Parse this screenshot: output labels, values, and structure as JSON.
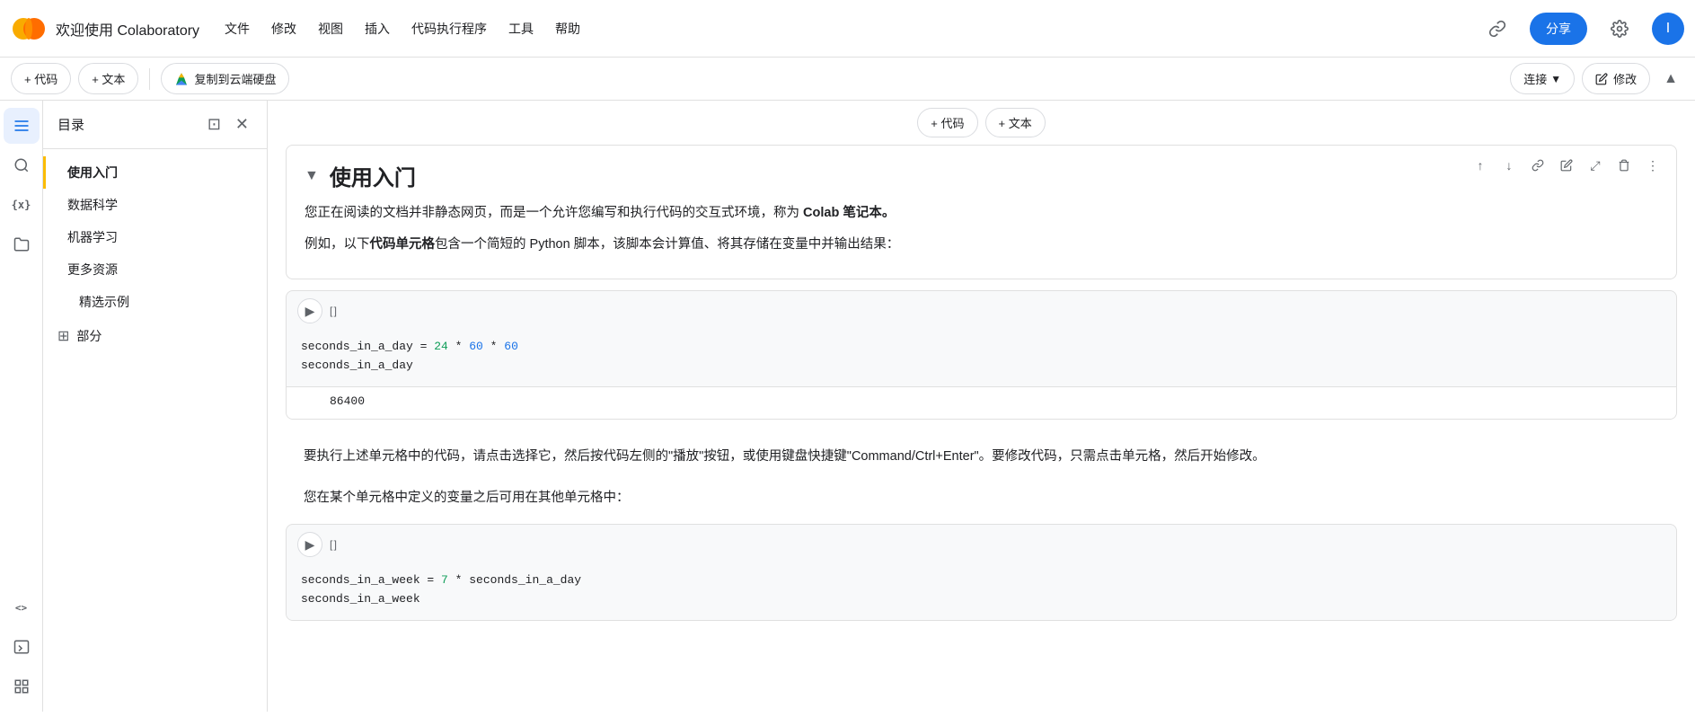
{
  "app": {
    "logo_text": "CO",
    "title": "欢迎使用 Colaboratory"
  },
  "menu": {
    "items": [
      "文件",
      "修改",
      "视图",
      "插入",
      "代码执行程序",
      "工具",
      "帮助"
    ]
  },
  "top_bar_right": {
    "link_icon": "🔗",
    "share_label": "分享",
    "settings_icon": "⚙",
    "user_avatar": "I"
  },
  "toolbar": {
    "add_code": "+ 代码",
    "add_text": "+ 文本",
    "copy_to_drive": "复制到云端硬盘",
    "connect_label": "连接",
    "edit_label": "修改",
    "collapse_icon": "▲"
  },
  "cell_insert": {
    "add_code": "+ 代码",
    "add_text": "+ 文本"
  },
  "sidebar": {
    "title": "目录",
    "toc_items": [
      {
        "label": "使用入门",
        "active": true,
        "indent": 1
      },
      {
        "label": "数据科学",
        "active": false,
        "indent": 1
      },
      {
        "label": "机器学习",
        "active": false,
        "indent": 1
      },
      {
        "label": "更多资源",
        "active": false,
        "indent": 1
      },
      {
        "label": "精选示例",
        "active": false,
        "indent": 2
      }
    ],
    "section_label": "部分"
  },
  "strip_icons": [
    {
      "icon": "☰",
      "name": "toc-icon",
      "active": true
    },
    {
      "icon": "🔍",
      "name": "search-icon",
      "active": false
    },
    {
      "icon": "{x}",
      "name": "variables-icon",
      "active": false
    },
    {
      "icon": "📁",
      "name": "files-icon",
      "active": false
    },
    {
      "icon": "<>",
      "name": "code-snippets-icon",
      "active": false
    },
    {
      "icon": "≡",
      "name": "terminal-icon",
      "active": false
    },
    {
      "icon": "⊞",
      "name": "extensions-icon",
      "active": false
    }
  ],
  "main": {
    "section_title": "使用入门",
    "intro_p1": "您正在阅读的文档并非静态网页，而是一个允许您编写和执行代码的交互式环境，称为 Colab 笔记本。",
    "intro_bold": "Colab 笔记本。",
    "intro_p2_prefix": "例如，以下",
    "intro_code_bold": "代码单元格",
    "intro_p2_suffix": "包含一个简短的 Python 脚本，该脚本会计算值、将其存储在变量中并输出结果：",
    "code_cell_1": {
      "bracket": "[ ]",
      "line1_part1": "seconds_in_a_day",
      "line1_eq": " = ",
      "line1_n1": "24",
      "line1_op1": " * ",
      "line1_n2": "60",
      "line1_op2": " * ",
      "line1_n3": "60",
      "line2": "seconds_in_a_day",
      "output": "86400"
    },
    "para2": "要执行上述单元格中的代码，请点击选择它，然后按代码左侧的\"播放\"按钮，或使用键盘快捷键\"Command/Ctrl+Enter\"。要修改代码，只需点击单元格，然后开始修改。",
    "para3": "您在某个单元格中定义的变量之后可用在其他单元格中：",
    "code_cell_2": {
      "bracket": "[ ]",
      "line1_part1": "seconds_in_a_week",
      "line1_eq": " = ",
      "line1_n1": "7",
      "line1_op1": " * ",
      "line1_var": "seconds_in_a_day",
      "line2": "seconds_in_a_week"
    }
  },
  "cell_actions": {
    "move_up": "↑",
    "move_down": "↓",
    "link": "🔗",
    "edit": "✏",
    "expand": "⤢",
    "delete": "🗑",
    "more": "⋮"
  }
}
